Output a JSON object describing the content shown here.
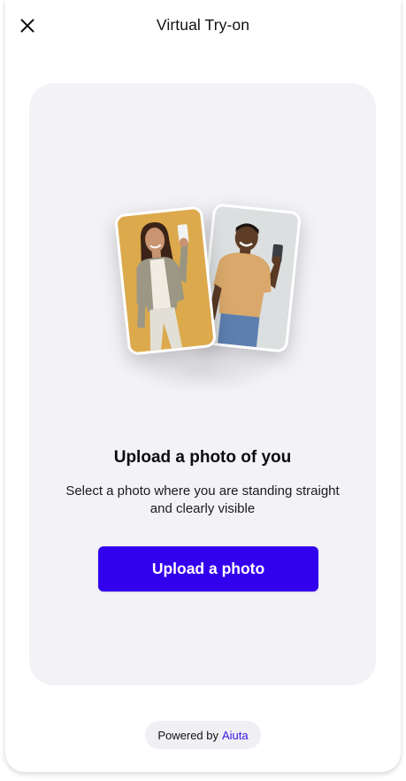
{
  "header": {
    "title": "Virtual Try-on",
    "close_icon": "close-icon"
  },
  "hero": {
    "images": [
      "woman-selfie-photo",
      "man-selfie-photo"
    ]
  },
  "content": {
    "heading": "Upload a photo of you",
    "description": "Select a photo where you are standing straight and clearly visible",
    "button_label": "Upload a photo"
  },
  "footer": {
    "powered_by": "Powered by",
    "brand": "Aiuta"
  },
  "colors": {
    "accent": "#3300ee",
    "card_background": "#f2f2f7",
    "brand_link": "#3a16e0"
  }
}
